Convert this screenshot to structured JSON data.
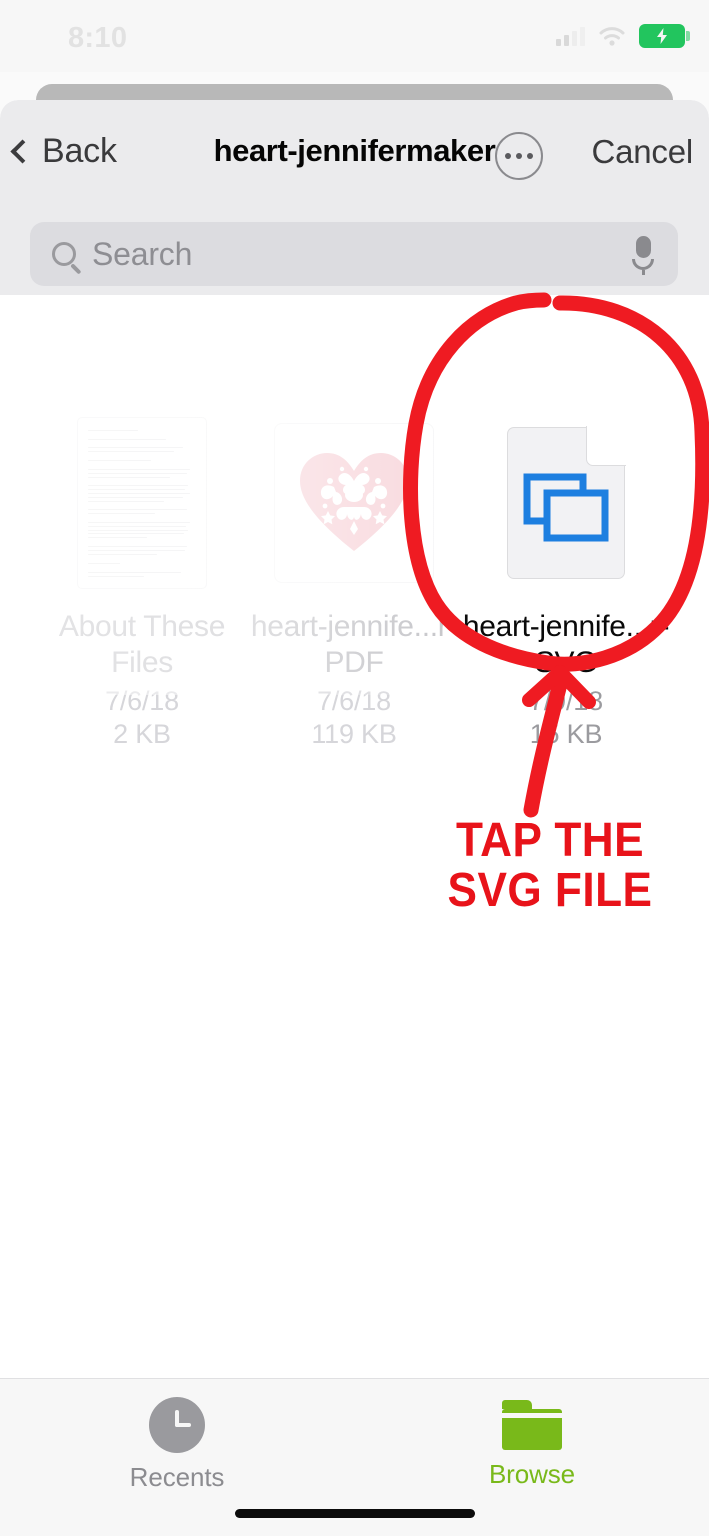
{
  "status_bar": {
    "time": "8:10",
    "icons": [
      "cellular-signal-icon",
      "wifi-icon",
      "battery-charging-icon"
    ],
    "battery_color": "#22c55e"
  },
  "nav": {
    "back_label": "Back",
    "title": "heart-jennifermaker",
    "more_label": "more-options",
    "cancel_label": "Cancel"
  },
  "search": {
    "placeholder": "Search",
    "mic_label": "dictate"
  },
  "files": [
    {
      "name": "About These Files",
      "date": "7/6/18",
      "size": "2 KB",
      "thumb": "text-document-thumbnail",
      "dimmed": true
    },
    {
      "name": "heart-jennife...r-PDF",
      "date": "7/6/18",
      "size": "119 KB",
      "thumb": "pink-heart-image-thumbnail",
      "thumb_color": "#f0a2ad",
      "dimmed": true
    },
    {
      "name": "heart-jennife...r-SVG",
      "date": "7/9/18",
      "size": "15 KB",
      "thumb": "svg-file-icon",
      "thumb_color": "#1d7fe0",
      "dimmed": false
    }
  ],
  "annotation": {
    "color": "#e8131a",
    "line1": "TAP THE",
    "line2": "SVG FILE",
    "shapes": [
      "hand-drawn-red-circle",
      "red-arrow-up"
    ]
  },
  "tab_bar": {
    "tabs": [
      {
        "label": "Recents",
        "icon": "clock-icon",
        "active": false
      },
      {
        "label": "Browse",
        "icon": "folder-icon",
        "active": true
      }
    ],
    "active_color": "#79b91a",
    "inactive_color": "#8c8c90"
  }
}
